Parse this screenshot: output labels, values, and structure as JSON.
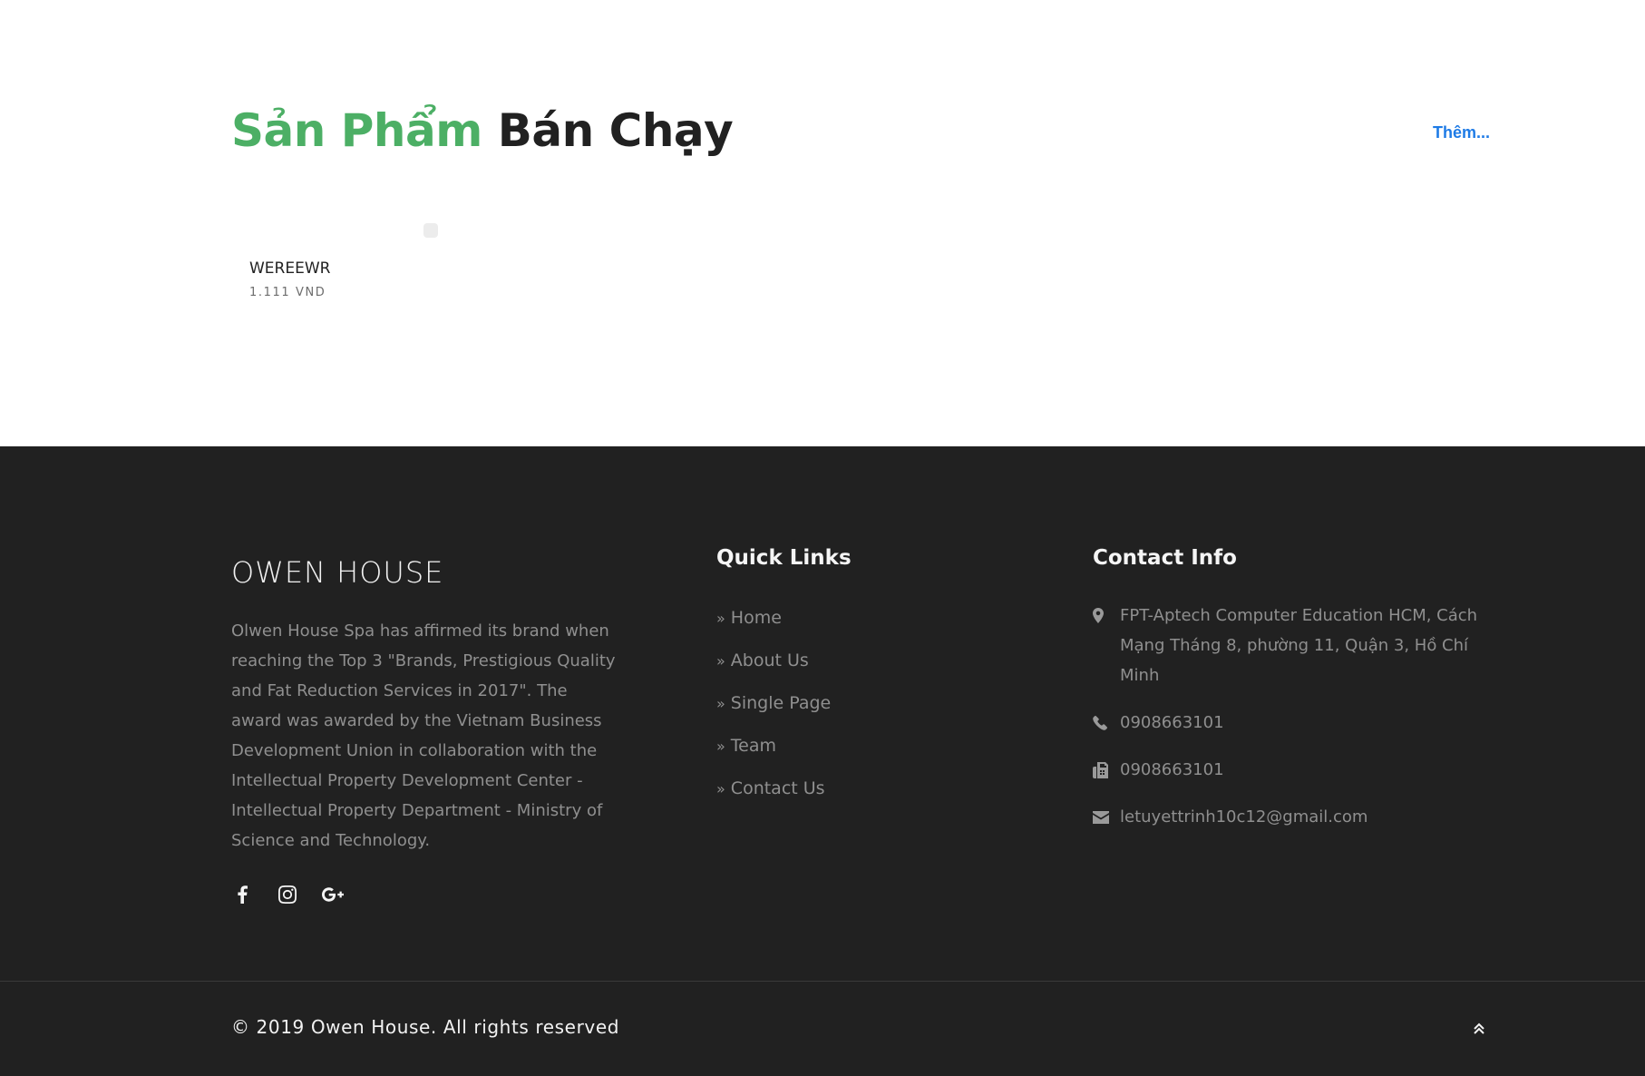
{
  "products_section": {
    "title_highlight": "Sản Phẩm",
    "title_rest": "Bán Chạy",
    "more_label": "Thêm...",
    "items": [
      {
        "name": "WEREEWR",
        "price": "1.111 VND"
      }
    ]
  },
  "footer": {
    "brand": "OWEN HOUSE",
    "about": "Olwen House Spa has affirmed its brand when reaching the Top 3 \"Brands, Prestigious Quality and Fat Reduction Services in 2017\". The award was awarded by the Vietnam Business Development Union in collaboration with the Intellectual Property Development Center - Intellectual Property Department - Ministry of Science and Technology.",
    "socials": [
      "facebook-icon",
      "instagram-icon",
      "google-plus-icon"
    ],
    "quick_links": {
      "title": "Quick Links",
      "items": [
        "Home",
        "About Us",
        "Single Page",
        "Team",
        "Contact Us"
      ]
    },
    "contact": {
      "title": "Contact Info",
      "address": "FPT-Aptech Computer Education HCM, Cách Mạng Tháng 8, phường 11, Quận 3, Hồ Chí Minh",
      "phone": "0908663101",
      "fax": "0908663101",
      "email": "letuyettrinh10c12@gmail.com"
    },
    "copyright": "© 2019 Owen House. All rights reserved"
  },
  "colors": {
    "accent_green": "#4caf65",
    "link_blue": "#1e7be6",
    "footer_bg": "#212121"
  }
}
